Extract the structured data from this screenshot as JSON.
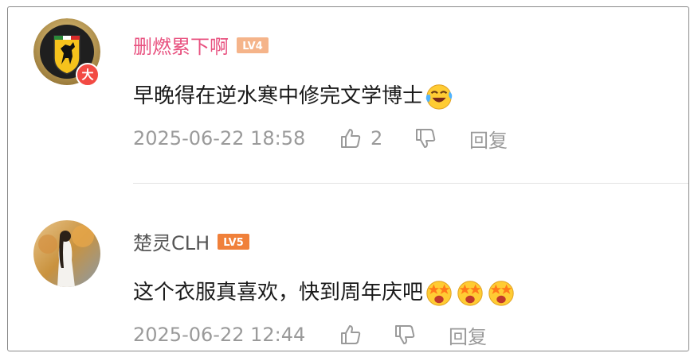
{
  "comments": [
    {
      "username": "删燃累下啊",
      "level": "LV4",
      "badge": "大",
      "text": "早晚得在逆水寒中修完文学博士",
      "emojis": [
        "laugh-cry-emoji"
      ],
      "timestamp": "2025-06-22 18:58",
      "like_count": "2",
      "reply_label": "回复"
    },
    {
      "username": "楚灵CLH",
      "level": "LV5",
      "text": "这个衣服真喜欢，快到周年庆吧",
      "emojis": [
        "starry-eyes-emoji",
        "starry-eyes-emoji",
        "starry-eyes-emoji"
      ],
      "timestamp": "2025-06-22 12:44",
      "like_count": "",
      "reply_label": "回复"
    }
  ],
  "colors": {
    "vip_name": "#e8517f",
    "normal_name": "#555555",
    "meta_text": "#9a9a9a",
    "lv4_badge": "#f5b48a",
    "lv5_badge": "#f0803a",
    "badge_red": "#f24a43"
  }
}
